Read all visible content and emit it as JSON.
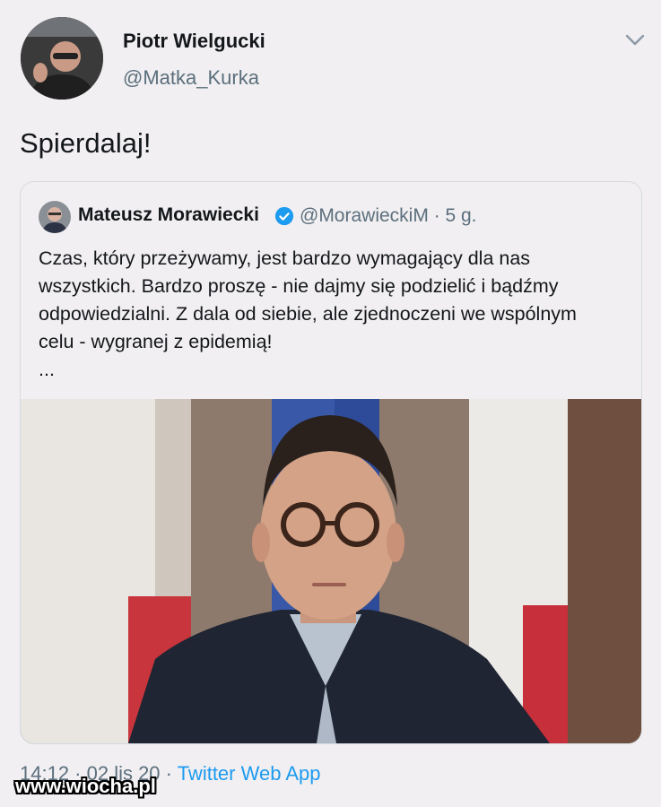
{
  "tweet": {
    "author_name": "Piotr Wielgucki",
    "author_handle": "@Matka_Kurka",
    "text": "Spierdalaj!",
    "menu_icon": "chevron-down-icon",
    "timestamp": "14:12 · 02 lis 20",
    "separator": " · ",
    "source": "Twitter Web App"
  },
  "quoted_tweet": {
    "author_name": "Mateusz Morawiecki",
    "verified_icon": "verified-badge-icon",
    "author_handle": "@MorawieckiM · 5 g.",
    "text": "Czas, który przeżywamy, jest bardzo wymagający dla nas\nwszystkich. Bardzo proszę - nie dajmy się podzielić i bądźmy\nodpowiedzialni. Z dala od siebie, ale zjednoczeni we wspólnym\ncelu - wygranej z epidemią!\n...",
    "media": "portrait-photo"
  },
  "watermark": "www.wiocha.pl",
  "colors": {
    "background": "#f1eff1",
    "text": "#14171a",
    "secondary": "#5b6f7d",
    "link": "#1d9bf0",
    "verified": "#1d9bf0"
  }
}
